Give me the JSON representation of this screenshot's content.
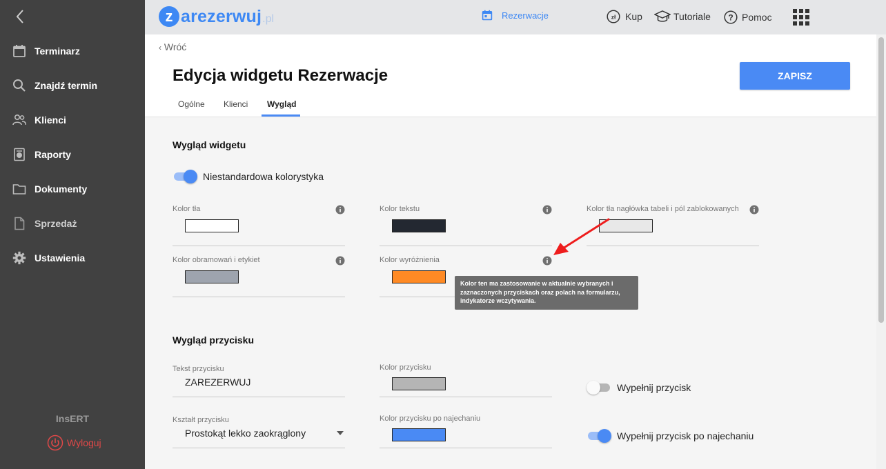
{
  "sidebar": {
    "items": [
      {
        "label": "Terminarz",
        "icon": "calendar-icon"
      },
      {
        "label": "Znajdź termin",
        "icon": "search-icon"
      },
      {
        "label": "Klienci",
        "icon": "people-icon"
      },
      {
        "label": "Raporty",
        "icon": "report-icon"
      },
      {
        "label": "Dokumenty",
        "icon": "folder-icon"
      },
      {
        "label": "Sprzedaż",
        "icon": "document-icon"
      },
      {
        "label": "Ustawienia",
        "icon": "gear-icon"
      }
    ],
    "brand": "InsERT",
    "logout": "Wyloguj"
  },
  "topbar": {
    "logo": {
      "first": "z",
      "rest": "arezerwuj",
      "suffix": ".pl"
    },
    "nav": {
      "reservations": "Rezerwacje",
      "buy": "Kup",
      "tutorials": "Tutoriale",
      "help": "Pomoc"
    }
  },
  "header": {
    "back": "Wróć",
    "title": "Edycja widgetu Rezerwacje",
    "save": "ZAPISZ",
    "tabs": [
      "Ogólne",
      "Klienci",
      "Wygląd"
    ],
    "active_tab": "Wygląd"
  },
  "widget_look": {
    "title": "Wygląd widgetu",
    "custom_colors": {
      "label": "Niestandardowa kolorystyka",
      "on": true
    },
    "fields": {
      "background": {
        "label": "Kolor tła",
        "color": "#ffffff"
      },
      "text": {
        "label": "Kolor tekstu",
        "color": "#232831"
      },
      "header": {
        "label": "Kolor tła nagłówka tabeli i pól zablokowanych",
        "color": "#e8e8e8"
      },
      "borders": {
        "label": "Kolor obramowań i etykiet",
        "color": "#9ea4ae"
      },
      "highlight": {
        "label": "Kolor wyróżnienia",
        "color": "#ff8a24"
      }
    },
    "tooltip": "Kolor ten ma zastosowanie w aktualnie wybranych i zaznaczonych przyciskach oraz polach na formularzu, indykatorze wczytywania."
  },
  "button_look": {
    "title": "Wygląd przycisku",
    "text": {
      "label": "Tekst przycisku",
      "value": "ZAREZERWUJ"
    },
    "color": {
      "label": "Kolor przycisku",
      "color": "#b5b5b5"
    },
    "fill": {
      "label": "Wypełnij przycisk",
      "on": false
    },
    "shape": {
      "label": "Kształt przycisku",
      "value": "Prostokąt lekko zaokrąglony"
    },
    "hover_color": {
      "label": "Kolor przycisku po najechaniu",
      "color": "#4a8af4"
    },
    "hover_fill": {
      "label": "Wypełnij przycisk po najechaniu",
      "on": true
    }
  },
  "colors": {
    "accent": "#4a8af4",
    "sidebar": "#414141",
    "danger": "#e04848"
  }
}
